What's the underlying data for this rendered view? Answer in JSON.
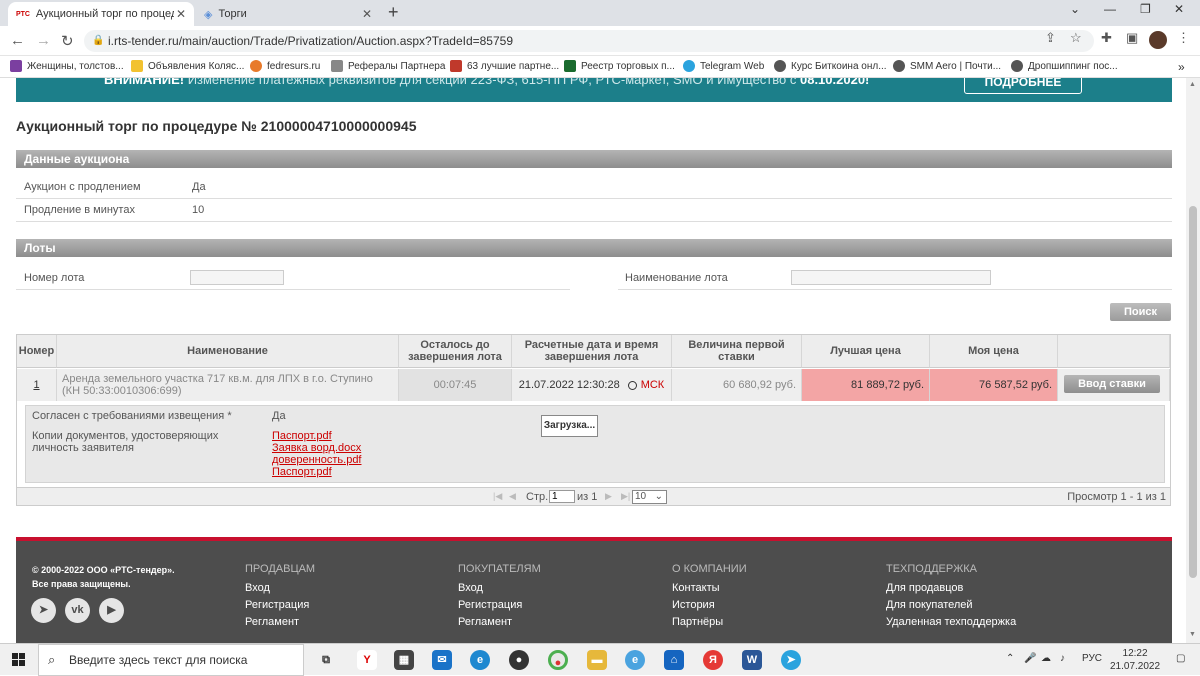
{
  "browser": {
    "tabs": [
      {
        "favicon": "РТС",
        "title": "Аукционный торг по процедуре",
        "active": true
      },
      {
        "title": "Торги",
        "active": false
      }
    ],
    "url": "i.rts-tender.ru/main/auction/Trade/Privatization/Auction.aspx?TradeId=85759",
    "bookmarks": [
      "Женщины, толстов...",
      "Объявления Коляс...",
      "fedresurs.ru",
      "Рефералы Партнера",
      "63 лучшие партне...",
      "Реестр торговых п...",
      "Telegram Web",
      "Курс Биткоина онл...",
      "SMM Aero | Почти...",
      "Дропшиппинг пос..."
    ]
  },
  "banner": {
    "prefix": "ВНИМАНИЕ!",
    "text": " Изменение платежных реквизитов для секций 223-ФЗ, 615-ПП РФ, РТС-маркет, SMO и Имущество с ",
    "date": "08.10.2020!",
    "button": "ПОДРОБНЕЕ"
  },
  "page": {
    "title": "Аукционный торг по процедуре № 21000004710000000945"
  },
  "auction_data": {
    "header": "Данные аукциона",
    "rows": [
      {
        "label": "Аукцион с продлением",
        "value": "Да"
      },
      {
        "label": "Продление в минутах",
        "value": "10"
      }
    ]
  },
  "lots": {
    "header": "Лоты",
    "filter_lot_number_label": "Номер лота",
    "filter_lot_name_label": "Наименование лота",
    "search_button": "Поиск"
  },
  "grid": {
    "columns": [
      "Номер",
      "Наименование",
      "Осталось до завершения лота",
      "Расчетные дата и время завершения лота",
      "Величина первой ставки",
      "Лучшая цена",
      "Моя цена",
      ""
    ],
    "row": {
      "number": "1",
      "name": "Аренда земельного участка 717 кв.м. для ЛПХ в г.о. Ступино (КН 50:33:0010306:699)",
      "remaining": "00:07:45",
      "end_datetime": "21.07.2022 12:30:28",
      "timezone": "МСК",
      "first_bid": "60 680,92 руб.",
      "best_price": "81 889,72 руб.",
      "my_price": "76 587,52 руб.",
      "bid_button": "Ввод ставки"
    },
    "details": {
      "agree_label": "Согласен с требованиями извещения *",
      "agree_value": "Да",
      "docs_label": "Копии документов, удостоверяющих личность заявителя",
      "docs": [
        "Паспорт.pdf",
        "Заявка ворд.docx",
        "доверенность.pdf",
        "Паспорт.pdf"
      ],
      "loading": "Загрузка..."
    },
    "pager": {
      "page_label": "Стр.",
      "page_value": "1",
      "of_label": "из 1",
      "page_size": "10",
      "summary": "Просмотр 1 - 1 из 1"
    }
  },
  "footer": {
    "copyright_line1": "© 2000-2022 ООО «РТС-тендер».",
    "copyright_line2": "Все права защищены.",
    "columns": [
      {
        "title": "Продавцам",
        "links": [
          "Вход",
          "Регистрация",
          "Регламент"
        ]
      },
      {
        "title": "Покупателям",
        "links": [
          "Вход",
          "Регистрация",
          "Регламент"
        ]
      },
      {
        "title": "О компании",
        "links": [
          "Контакты",
          "История",
          "Партнёры"
        ]
      },
      {
        "title": "Техподдержка",
        "links": [
          "Для продавцов",
          "Для покупателей",
          "Удаленная техподдержка"
        ]
      }
    ]
  },
  "taskbar": {
    "search_placeholder": "Введите здесь текст для поиска",
    "lang": "РУС",
    "time": "12:22",
    "date": "21.07.2022"
  }
}
